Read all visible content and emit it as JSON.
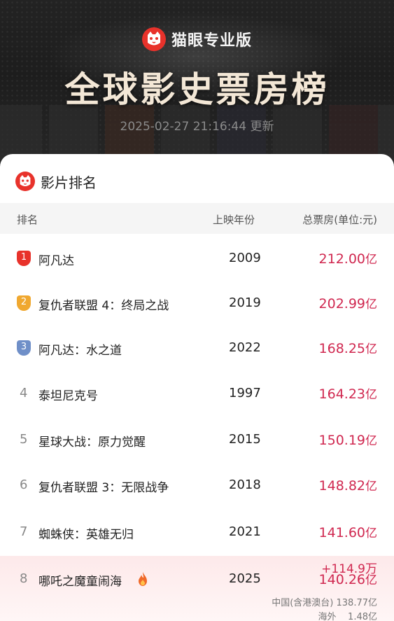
{
  "header": {
    "brand": "猫眼专业版",
    "title": "全球影史票房榜",
    "updated": "2025-02-27 21:16:44 更新"
  },
  "section": {
    "title": "影片排名"
  },
  "table": {
    "headers": {
      "rank": "排名",
      "year": "上映年份",
      "box": "总票房(单位:元)"
    },
    "rows": [
      {
        "rank": "1",
        "title": "阿凡达",
        "year": "2009",
        "box": "212.00",
        "unit": "亿"
      },
      {
        "rank": "2",
        "title": "复仇者联盟 4：终局之战",
        "year": "2019",
        "box": "202.99",
        "unit": "亿"
      },
      {
        "rank": "3",
        "title": "阿凡达：水之道",
        "year": "2022",
        "box": "168.25",
        "unit": "亿"
      },
      {
        "rank": "4",
        "title": "泰坦尼克号",
        "year": "1997",
        "box": "164.23",
        "unit": "亿"
      },
      {
        "rank": "5",
        "title": "星球大战：原力觉醒",
        "year": "2015",
        "box": "150.19",
        "unit": "亿"
      },
      {
        "rank": "6",
        "title": "复仇者联盟 3：无限战争",
        "year": "2018",
        "box": "148.82",
        "unit": "亿"
      },
      {
        "rank": "7",
        "title": "蜘蛛侠：英雄无归",
        "year": "2021",
        "box": "141.60",
        "unit": "亿"
      }
    ],
    "highlight": {
      "rank": "8",
      "title": "哪吒之魔童闹海",
      "year": "2025",
      "box": "140.26",
      "unit": "亿",
      "increase": "+114.9万",
      "china": "中国(含港澳台) 138.77亿",
      "overseas": "海外    1.48亿"
    }
  },
  "colors": {
    "gold": "#f0a830",
    "silver": "#6f8fc8",
    "red": "#e8322b",
    "box": "#d02850"
  }
}
